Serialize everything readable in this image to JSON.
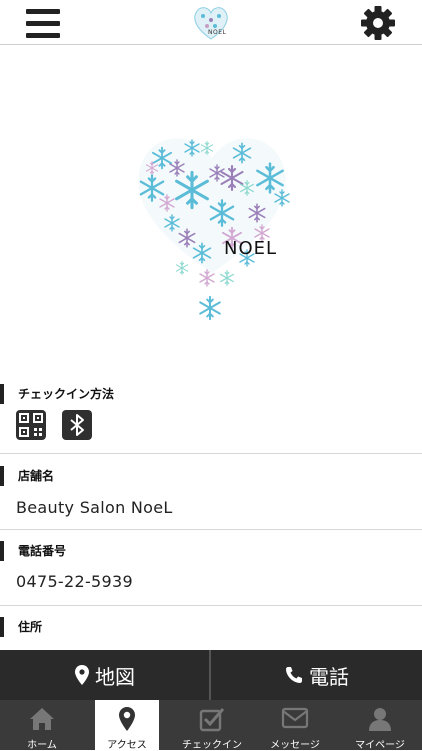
{
  "header": {
    "logo_text": "NOEL"
  },
  "hero": {
    "logo_text": "NOEL"
  },
  "sections": {
    "checkin": {
      "label": "チェックイン方法"
    },
    "shop": {
      "label": "店舗名",
      "value": "Beauty Salon NoeL"
    },
    "phone": {
      "label": "電話番号",
      "value": "0475-22-5939"
    },
    "address": {
      "label": "住所"
    }
  },
  "actions": {
    "map_label": "地図",
    "call_label": "電話"
  },
  "tabs": [
    {
      "label": "ホーム",
      "icon": "home-icon"
    },
    {
      "label": "アクセス",
      "icon": "map-pin-icon",
      "active": true
    },
    {
      "label": "チェックイン",
      "icon": "checkbox-icon"
    },
    {
      "label": "メッセージ",
      "icon": "envelope-icon"
    },
    {
      "label": "マイページ",
      "icon": "user-icon"
    }
  ],
  "colors": {
    "action_bar": "#2a2a2a",
    "tab_bar": "#3a3a3a",
    "snow_blue": "#5bbcd8",
    "snow_purple": "#9a7fb8"
  }
}
